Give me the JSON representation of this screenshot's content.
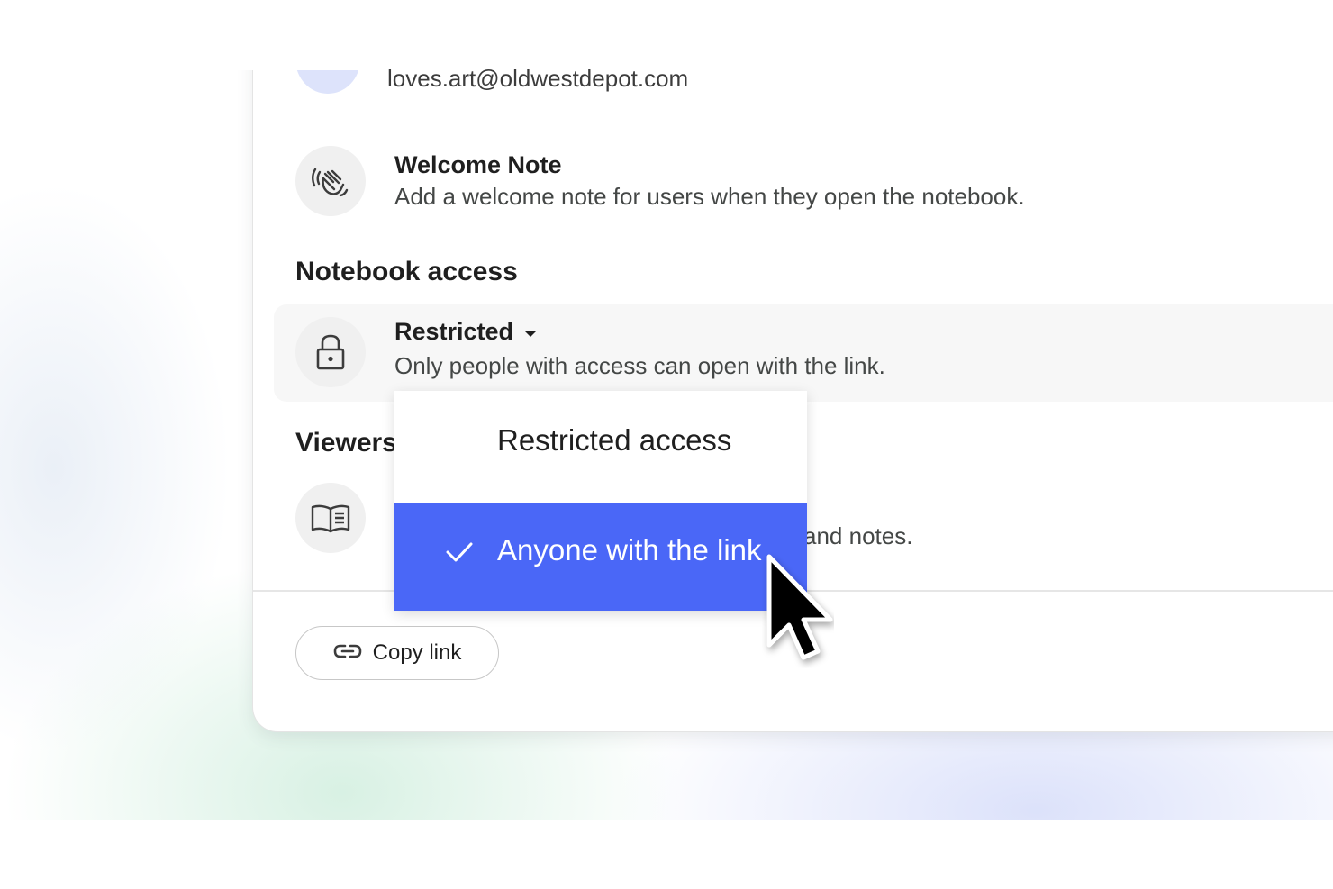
{
  "account": {
    "email": "loves.art@oldwestdepot.com"
  },
  "welcome_note": {
    "icon": "waving-hand-icon",
    "title": "Welcome Note",
    "description": "Add a welcome note for users when they open the notebook."
  },
  "notebook_access": {
    "heading": "Notebook access",
    "icon": "lock-icon",
    "selected_label": "Restricted",
    "description": "Only people with access can open with the link."
  },
  "viewers": {
    "heading": "Viewers",
    "icon": "open-book-icon",
    "description_tail": "and notes."
  },
  "access_menu": {
    "options": [
      {
        "label": "Restricted access",
        "checked": false
      },
      {
        "label": "Anyone with the link",
        "checked": true
      }
    ],
    "highlight_color": "#4a67f7"
  },
  "footer": {
    "copy_link_label": "Copy link",
    "copy_link_icon": "link-icon"
  }
}
